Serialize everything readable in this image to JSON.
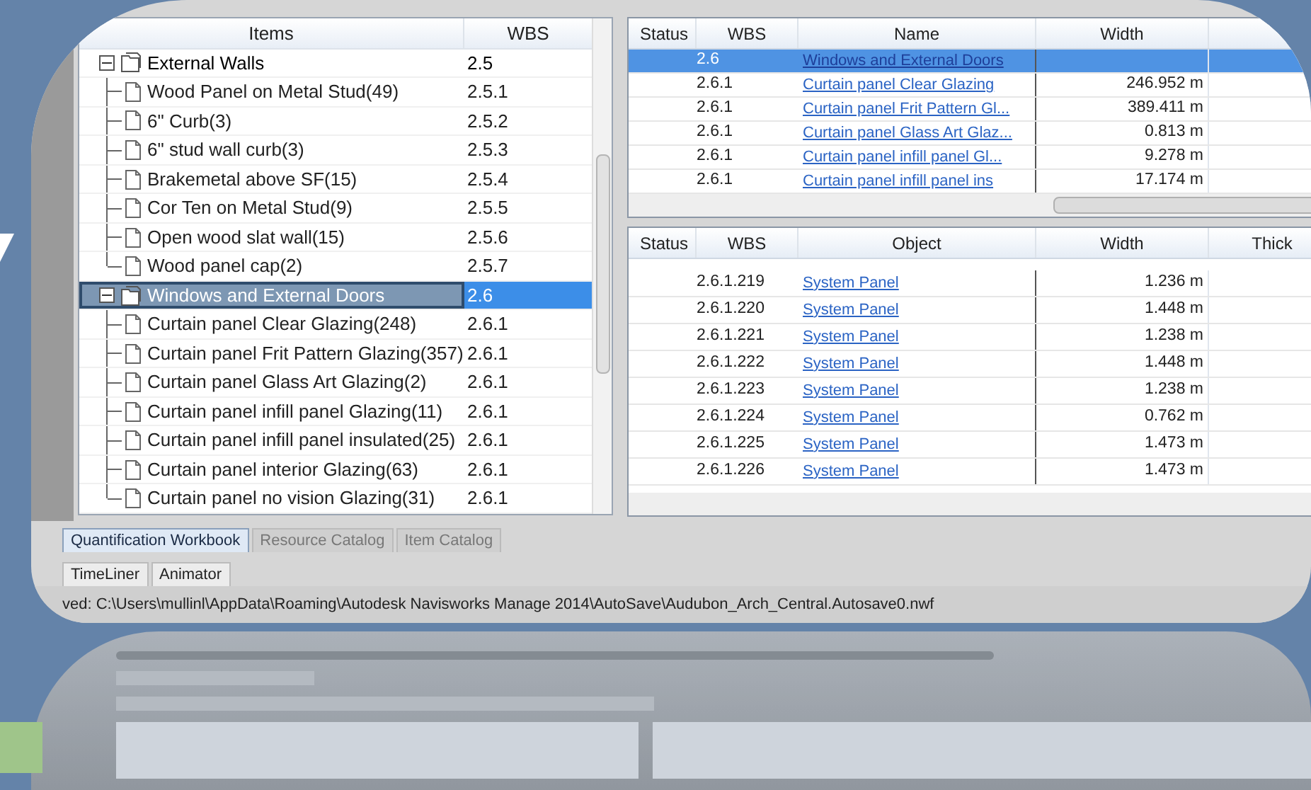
{
  "tree": {
    "columns": [
      "Items",
      "WBS"
    ],
    "rows": [
      {
        "label": "External Walls",
        "wbs": "2.5",
        "expanded": true,
        "selected": false,
        "children": [
          {
            "label": "Wood Panel on Metal Stud(49)",
            "wbs": "2.5.1",
            "selected": false
          },
          {
            "label": "6\" Curb(3)",
            "wbs": "2.5.2",
            "selected": false
          },
          {
            "label": "6\" stud wall curb(3)",
            "wbs": "2.5.3",
            "selected": false
          },
          {
            "label": "Brakemetal above SF(15)",
            "wbs": "2.5.4",
            "selected": false
          },
          {
            "label": "Cor Ten on Metal Stud(9)",
            "wbs": "2.5.5",
            "selected": false
          },
          {
            "label": "Open wood slat wall(15)",
            "wbs": "2.5.6",
            "selected": false
          },
          {
            "label": "Wood panel cap(2)",
            "wbs": "2.5.7",
            "selected": false
          }
        ]
      },
      {
        "label": "Windows and External Doors",
        "wbs": "2.6",
        "expanded": true,
        "selected": true,
        "children": [
          {
            "label": "Curtain panel Clear Glazing(248)",
            "wbs": "2.6.1",
            "selected": false
          },
          {
            "label": "Curtain panel Frit Pattern Glazing(357)",
            "wbs": "2.6.1",
            "selected": false
          },
          {
            "label": "Curtain panel Glass Art Glazing(2)",
            "wbs": "2.6.1",
            "selected": false
          },
          {
            "label": "Curtain panel infill panel Glazing(11)",
            "wbs": "2.6.1",
            "selected": false
          },
          {
            "label": "Curtain panel infill panel insulated(25)",
            "wbs": "2.6.1",
            "selected": false
          },
          {
            "label": "Curtain panel interior Glazing(63)",
            "wbs": "2.6.1",
            "selected": false
          },
          {
            "label": "Curtain panel no vision Glazing(31)",
            "wbs": "2.6.1",
            "selected": false
          }
        ]
      }
    ]
  },
  "items_grid": {
    "columns": [
      "Status",
      "WBS",
      "Name",
      "Width"
    ],
    "rows": [
      {
        "wbs": "2.6",
        "name": "Windows and External Doors",
        "width": "",
        "selected": true
      },
      {
        "wbs": "2.6.1",
        "name": "Curtain panel Clear Glazing",
        "width": "246.952 m",
        "selected": false
      },
      {
        "wbs": "2.6.1",
        "name": "Curtain panel Frit Pattern Gl...",
        "width": "389.411 m",
        "selected": false
      },
      {
        "wbs": "2.6.1",
        "name": "Curtain panel Glass Art Glaz...",
        "width": "0.813 m",
        "selected": false
      },
      {
        "wbs": "2.6.1",
        "name": "Curtain panel infill panel Gl...",
        "width": "9.278 m",
        "selected": false
      },
      {
        "wbs": "2.6.1",
        "name": "Curtain panel infill panel ins",
        "width": "17.174 m",
        "selected": false
      }
    ]
  },
  "objects_grid": {
    "columns": [
      "Status",
      "WBS",
      "Object",
      "Width",
      "Thick"
    ],
    "rows": [
      {
        "wbs": "2.6.1.219",
        "object": "System Panel",
        "width": "1.236 m"
      },
      {
        "wbs": "2.6.1.220",
        "object": "System Panel",
        "width": "1.448 m"
      },
      {
        "wbs": "2.6.1.221",
        "object": "System Panel",
        "width": "1.238 m"
      },
      {
        "wbs": "2.6.1.222",
        "object": "System Panel",
        "width": "1.448 m"
      },
      {
        "wbs": "2.6.1.223",
        "object": "System Panel",
        "width": "1.238 m"
      },
      {
        "wbs": "2.6.1.224",
        "object": "System Panel",
        "width": "0.762 m"
      },
      {
        "wbs": "2.6.1.225",
        "object": "System Panel",
        "width": "1.473 m"
      },
      {
        "wbs": "2.6.1.226",
        "object": "System Panel",
        "width": "1.473 m"
      }
    ]
  },
  "tabs": [
    {
      "label": "Quantification Workbook",
      "selected": true
    },
    {
      "label": "Resource Catalog",
      "selected": false
    },
    {
      "label": "Item Catalog",
      "selected": false
    }
  ],
  "bottom_tabs": [
    {
      "label": "TimeLiner",
      "selected": false
    },
    {
      "label": "Animator",
      "selected": false
    }
  ],
  "status_bar": "ved: C:\\Users\\mullinl\\AppData\\Roaming\\Autodesk Navisworks Manage 2014\\AutoSave\\Audubon_Arch_Central.Autosave0.nwf"
}
